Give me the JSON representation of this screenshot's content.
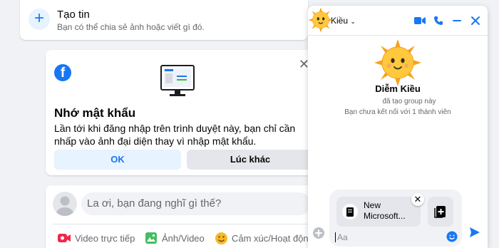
{
  "story": {
    "title": "Tạo tin",
    "subtitle": "Bạn có thể chia sẻ ảnh hoặc viết gì đó."
  },
  "password_prompt": {
    "title": "Nhớ mật khẩu",
    "text": "Lần tới khi đăng nhập trên trình duyệt này, bạn chỉ cần nhấp vào ảnh đại diện thay vì nhập mật khẩu.",
    "ok_label": "OK",
    "later_label": "Lúc khác"
  },
  "composer": {
    "placeholder": "La ơi, bạn đang nghĩ gì thế?",
    "actions": [
      {
        "label": "Video trực tiếp",
        "icon": "live-video-icon"
      },
      {
        "label": "Ảnh/Video",
        "icon": "photo-icon"
      },
      {
        "label": "Cảm xúc/Hoạt động",
        "icon": "feeling-icon"
      }
    ]
  },
  "chat": {
    "header_name": "Kiều",
    "name": "Diễm Kiều",
    "info_created": "đã tạo group này",
    "info_connection": "Bạn chưa kết nối với 1 thành viên",
    "attachment": {
      "name_line1": "New",
      "name_line2": "Microsoft..."
    },
    "input_placeholder": "Aa"
  },
  "colors": {
    "brand_blue": "#1877f2",
    "background": "#f0f2f5",
    "sun_yellow": "#ffc83d"
  }
}
